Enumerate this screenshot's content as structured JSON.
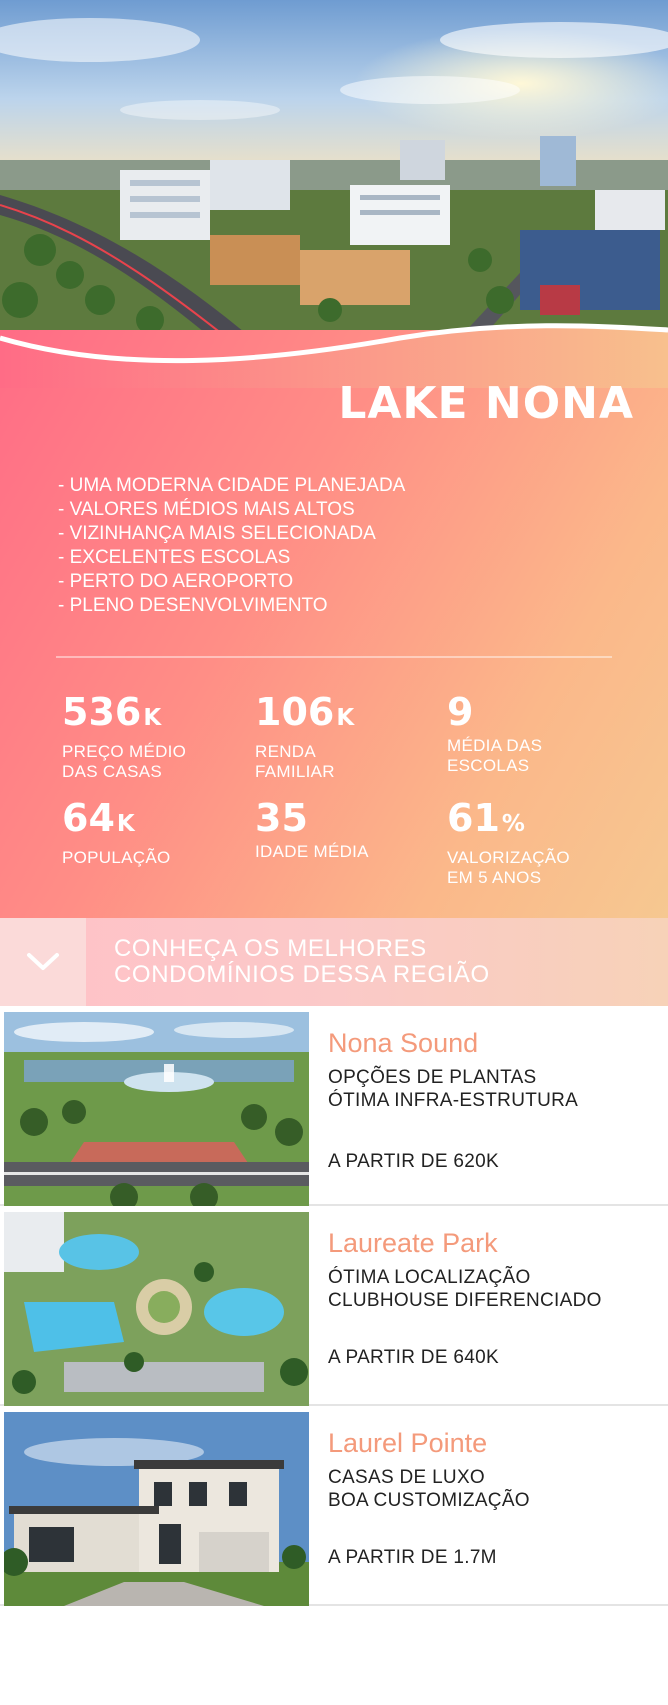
{
  "city": {
    "title": "LAKE NONA"
  },
  "features": [
    "- UMA MODERNA CIDADE PLANEJADA",
    "- VALORES MÉDIOS MAIS ALTOS",
    "- VIZINHANÇA MAIS SELECIONADA",
    "- EXCELENTES ESCOLAS",
    "- PERTO DO AEROPORTO",
    "- PLENO DESENVOLVIMENTO"
  ],
  "stats": [
    {
      "value": "536",
      "suffix": "K",
      "label_1": "PREÇO MÉDIO",
      "label_2": "DAS CASAS"
    },
    {
      "value": "106",
      "suffix": "K",
      "label_1": "RENDA",
      "label_2": "FAMILIAR"
    },
    {
      "value": "9",
      "suffix": "",
      "label_1": "MÉDIA DAS",
      "label_2": "ESCOLAS"
    },
    {
      "value": "64",
      "suffix": "K",
      "label_1": "POPULAÇÃO",
      "label_2": ""
    },
    {
      "value": "35",
      "suffix": "",
      "label_1": "IDADE MÉDIA",
      "label_2": ""
    },
    {
      "value": "61",
      "suffix": "%",
      "label_1": "VALORIZAÇÃO",
      "label_2": "EM 5 ANOS"
    }
  ],
  "cta": {
    "line_1": "CONHEÇA OS MELHORES",
    "line_2": "CONDOMÍNIOS DESSA REGIÃO",
    "icon": "chevron-down-icon"
  },
  "listings": [
    {
      "name": "Nona Sound",
      "feature_1": "OPÇÕES DE PLANTAS",
      "feature_2": "ÓTIMA INFRA-ESTRUTURA",
      "price": "A PARTIR DE 620K"
    },
    {
      "name": "Laureate Park",
      "feature_1": "ÓTIMA LOCALIZAÇÃO",
      "feature_2": "CLUBHOUSE DIFERENCIADO",
      "price": "A PARTIR DE 640K"
    },
    {
      "name": "Laurel Pointe",
      "feature_1": "CASAS DE LUXO",
      "feature_2": "BOA CUSTOMIZAÇÃO",
      "price": "A PARTIR DE 1.7M"
    }
  ],
  "colors": {
    "gradient_start": "#ff6c86",
    "gradient_end": "#f6c891",
    "listing_name": "#f49a7b",
    "cta_bar": "#fbc9c8"
  }
}
